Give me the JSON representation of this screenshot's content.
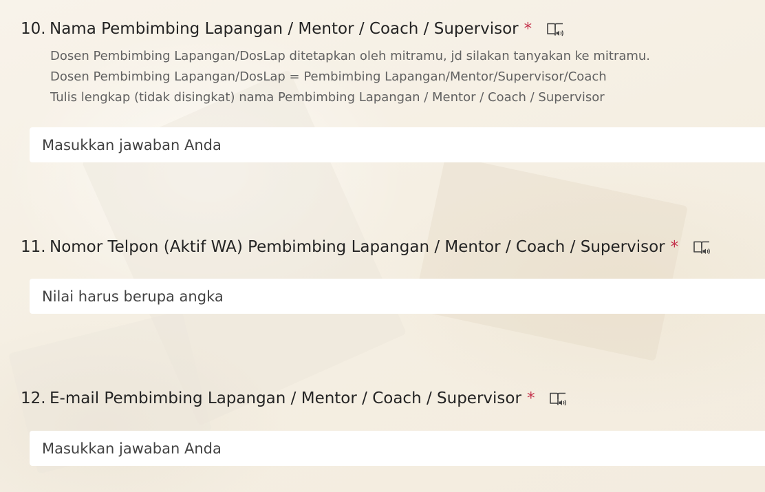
{
  "questions": [
    {
      "number": "10.",
      "title": "Nama Pembimbing Lapangan / Mentor / Coach / Supervisor",
      "required_mark": "*",
      "description": [
        "Dosen Pembimbing Lapangan/DosLap ditetapkan oleh mitramu, jd silakan tanyakan ke mitramu.",
        "Dosen Pembimbing Lapangan/DosLap = Pembimbing Lapangan/Mentor/Supervisor/Coach",
        "Tulis lengkap (tidak disingkat) nama Pembimbing Lapangan / Mentor / Coach / Supervisor"
      ],
      "input_value": "",
      "placeholder": "Masukkan jawaban Anda",
      "reader_icon": "immersive-reader-icon"
    },
    {
      "number": "11.",
      "title": "Nomor Telpon (Aktif WA) Pembimbing Lapangan / Mentor / Coach / Supervisor",
      "required_mark": "*",
      "input_value": "",
      "placeholder": "Nilai harus berupa angka",
      "reader_icon": "immersive-reader-icon"
    },
    {
      "number": "12.",
      "title": "E-mail Pembimbing Lapangan / Mentor / Coach / Supervisor",
      "required_mark": "*",
      "input_value": "",
      "placeholder": "Masukkan jawaban Anda",
      "reader_icon": "immersive-reader-icon"
    }
  ],
  "colors": {
    "required": "#c4314b",
    "text": "#242424",
    "description": "#616161",
    "input_bg": "#ffffff"
  }
}
